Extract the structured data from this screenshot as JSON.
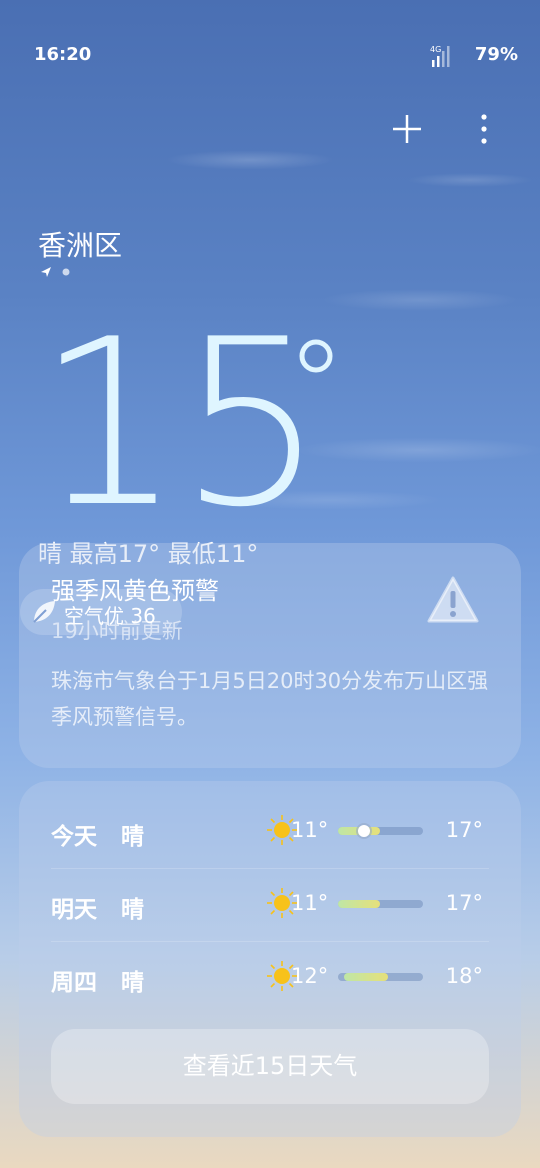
{
  "status_bar": {
    "time": "16:20",
    "network": "4G",
    "battery": "79%"
  },
  "header": {
    "add_icon": "plus-icon",
    "menu_icon": "more-vertical-icon"
  },
  "location": {
    "city": "香洲区"
  },
  "current": {
    "temperature": "15",
    "summary": "晴  最高17° 最低11°"
  },
  "air_quality": {
    "label": "空气优 36"
  },
  "alert": {
    "title": "强季风黄色预警",
    "updated": "19小时前更新",
    "body": "珠海市气象台于1月5日20时30分发布万山区强季风预警信号。",
    "icon": "warning-icon"
  },
  "forecast": [
    {
      "day": "今天",
      "condition": "晴",
      "icon": "sun-icon",
      "low": "11°",
      "high": "17°"
    },
    {
      "day": "明天",
      "condition": "晴",
      "icon": "sun-icon",
      "low": "11°",
      "high": "17°"
    },
    {
      "day": "周四",
      "condition": "晴",
      "icon": "sun-icon",
      "low": "12°",
      "high": "18°"
    }
  ],
  "forecast_button": "查看近15日天气",
  "colors": {
    "temperature": "#dff5ff",
    "bar_start": "#bfe6a6",
    "bar_end": "#e6e07a",
    "sun": "#f7c21a"
  }
}
